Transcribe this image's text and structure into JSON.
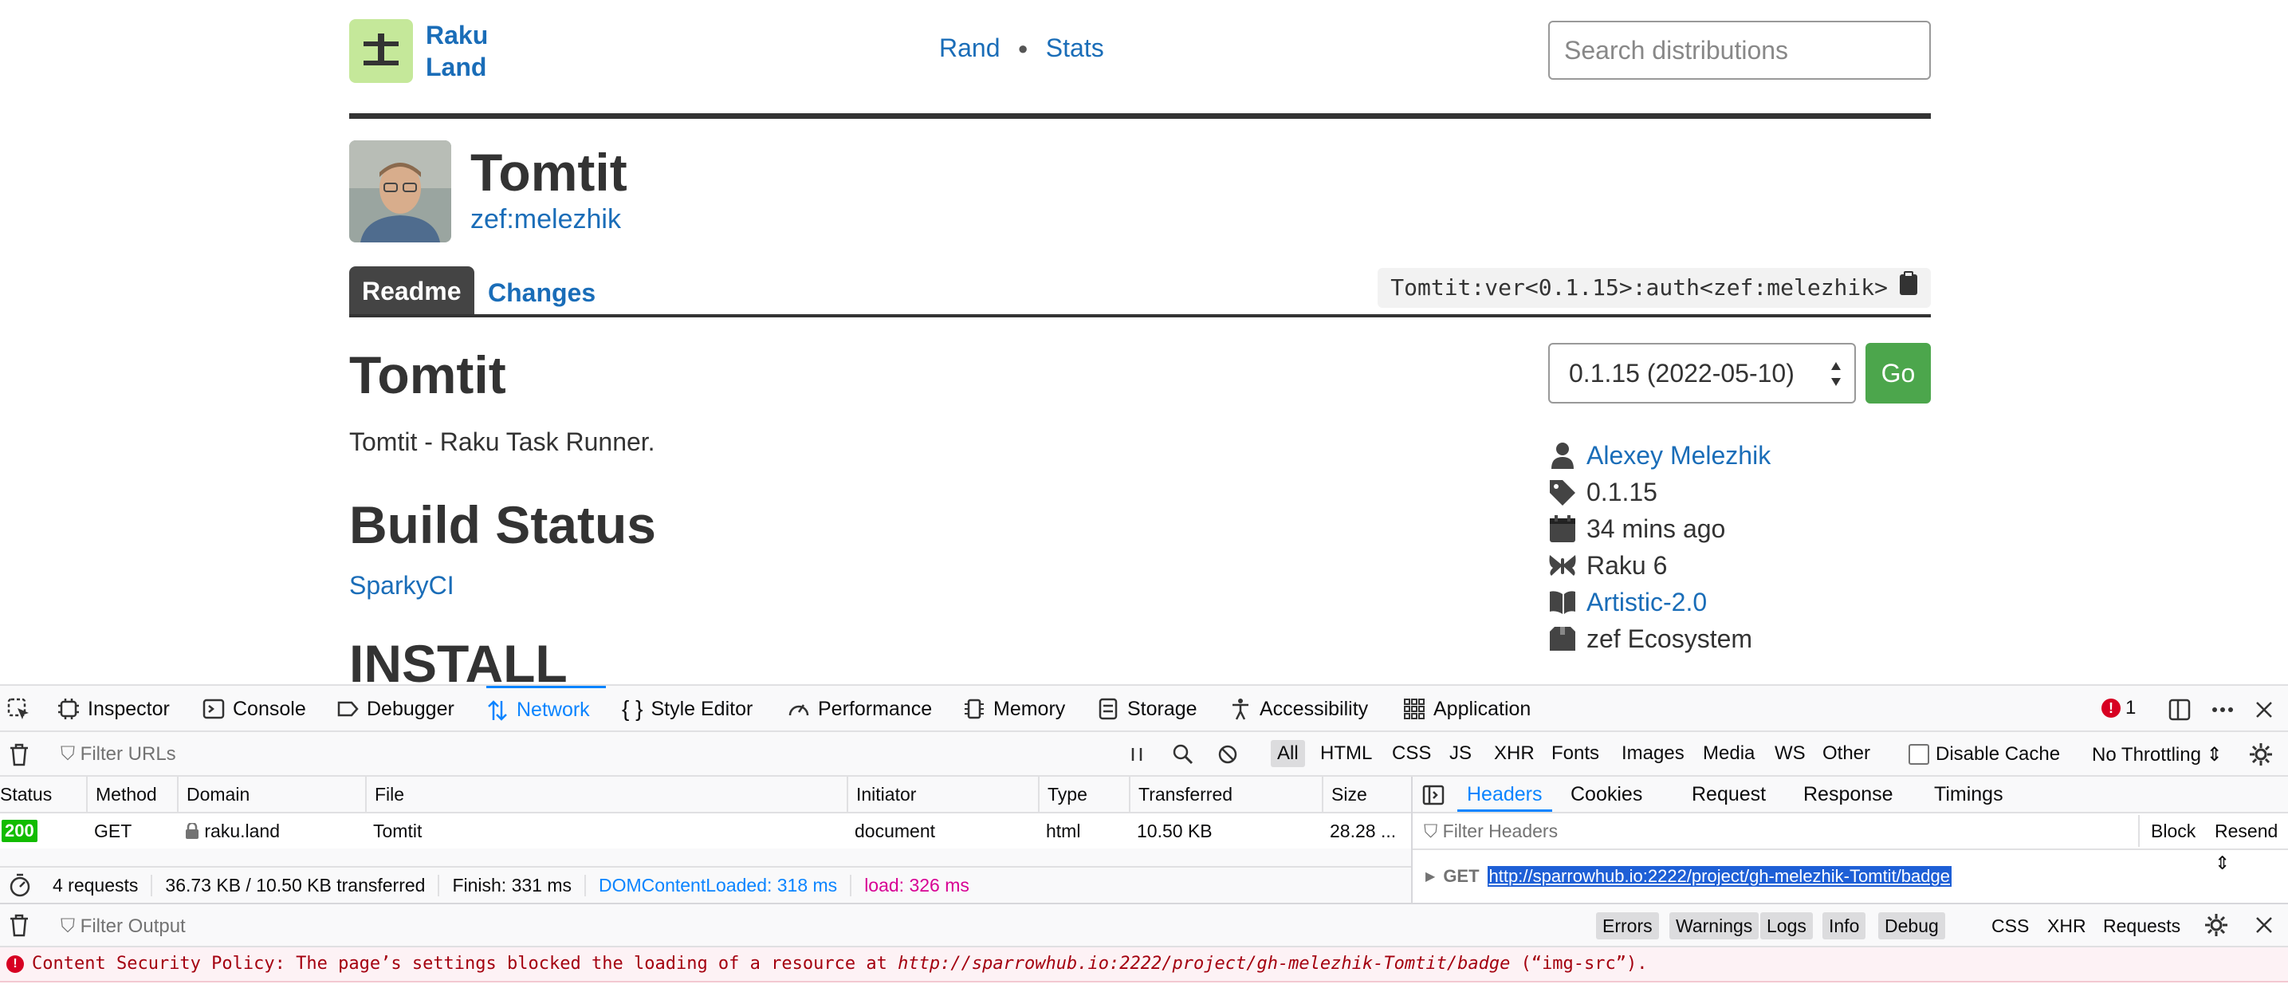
{
  "site": {
    "logo_line1": "Raku",
    "logo_line2": "Land",
    "nav": [
      "Rand",
      "Stats"
    ],
    "search_placeholder": "Search distributions"
  },
  "dist": {
    "name": "Tomtit",
    "auth": "zef:melezhik",
    "tabs": [
      "Readme",
      "Changes"
    ],
    "identity": "Tomtit:ver<0.1.15>:auth<zef:melezhik>",
    "version_select": "0.1.15 (2022-05-10)",
    "go": "Go",
    "meta": {
      "author": "Alexey Melezhik",
      "version": "0.1.15",
      "age": "34 mins ago",
      "raku": "Raku 6",
      "license": "Artistic-2.0",
      "ecosystem": "zef Ecosystem"
    }
  },
  "readme": {
    "h1": "Tomtit",
    "desc": "Tomtit - Raku Task Runner.",
    "h2": "Build Status",
    "badge_link": "SparkyCI",
    "h3": "INSTALL"
  },
  "devtools": {
    "tabs": [
      "Inspector",
      "Console",
      "Debugger",
      "Network",
      "Style Editor",
      "Performance",
      "Memory",
      "Storage",
      "Accessibility",
      "Application"
    ],
    "error_count": "1",
    "filter_urls": "Filter URLs",
    "filter_types": [
      "All",
      "HTML",
      "CSS",
      "JS",
      "XHR",
      "Fonts",
      "Images",
      "Media",
      "WS",
      "Other"
    ],
    "disable_cache": "Disable Cache",
    "throttling": "No Throttling",
    "columns": [
      "Status",
      "Method",
      "Domain",
      "File",
      "Initiator",
      "Type",
      "Transferred",
      "Size"
    ],
    "row": {
      "status": "200",
      "method": "GET",
      "domain": "raku.land",
      "file": "Tomtit",
      "initiator": "document",
      "type": "html",
      "transferred": "10.50 KB",
      "size": "28.28 ..."
    },
    "summary": {
      "requests": "4 requests",
      "transferred": "36.73 KB / 10.50 KB transferred",
      "finish": "Finish: 331 ms",
      "dcl": "DOMContentLoaded: 318 ms",
      "load": "load: 326 ms"
    },
    "side_tabs": [
      "Headers",
      "Cookies",
      "Request",
      "Response",
      "Timings"
    ],
    "filter_headers": "Filter Headers",
    "block": "Block",
    "resend": "Resend",
    "req_method": "GET",
    "req_url": "http://sparrowhub.io:2222/project/gh-melezhik-Tomtit/badge",
    "filter_output": "Filter Output",
    "levels": [
      "Errors",
      "Warnings",
      "Logs",
      "Info",
      "Debug"
    ],
    "console_filters": [
      "CSS",
      "XHR",
      "Requests"
    ],
    "console_msg_pre": "Content Security Policy: The page’s settings blocked the loading of a resource at ",
    "console_msg_url": "http://sparrowhub.io:2222/project/gh-melezhik-Tomtit/badge",
    "console_msg_post": " (“img-src”).",
    "colors": {
      "accent": "#0a84ff",
      "error": "#d70022",
      "status_ok": "#12bc00",
      "link": "#1a6db8",
      "go": "#4ca64c"
    }
  }
}
